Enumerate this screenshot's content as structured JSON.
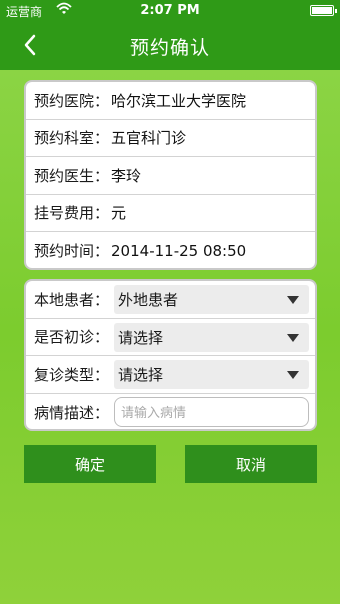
{
  "status_bar": {
    "carrier": "运营商",
    "time": "2:07 PM"
  },
  "nav": {
    "title": "预约确认"
  },
  "info": {
    "rows": [
      {
        "label": "预约医院：",
        "value": "哈尔滨工业大学医院"
      },
      {
        "label": "预约科室：",
        "value": "五官科门诊"
      },
      {
        "label": "预约医生：",
        "value": "李玲"
      },
      {
        "label": "挂号费用：",
        "value": "元"
      },
      {
        "label": "预约时间：",
        "value": "2014-11-25 08:50"
      }
    ]
  },
  "form": {
    "local_patient": {
      "label": "本地患者：",
      "value": "外地患者"
    },
    "first_visit": {
      "label": "是否初诊：",
      "value": "请选择"
    },
    "revisit_type": {
      "label": "复诊类型：",
      "value": "请选择"
    },
    "condition": {
      "label": "病情描述：",
      "placeholder": "请输入病情"
    }
  },
  "buttons": {
    "confirm": "确定",
    "cancel": "取消"
  },
  "colors": {
    "bar": "#2f9a17",
    "button": "#2f8f1c",
    "background": "#8fd64a"
  }
}
